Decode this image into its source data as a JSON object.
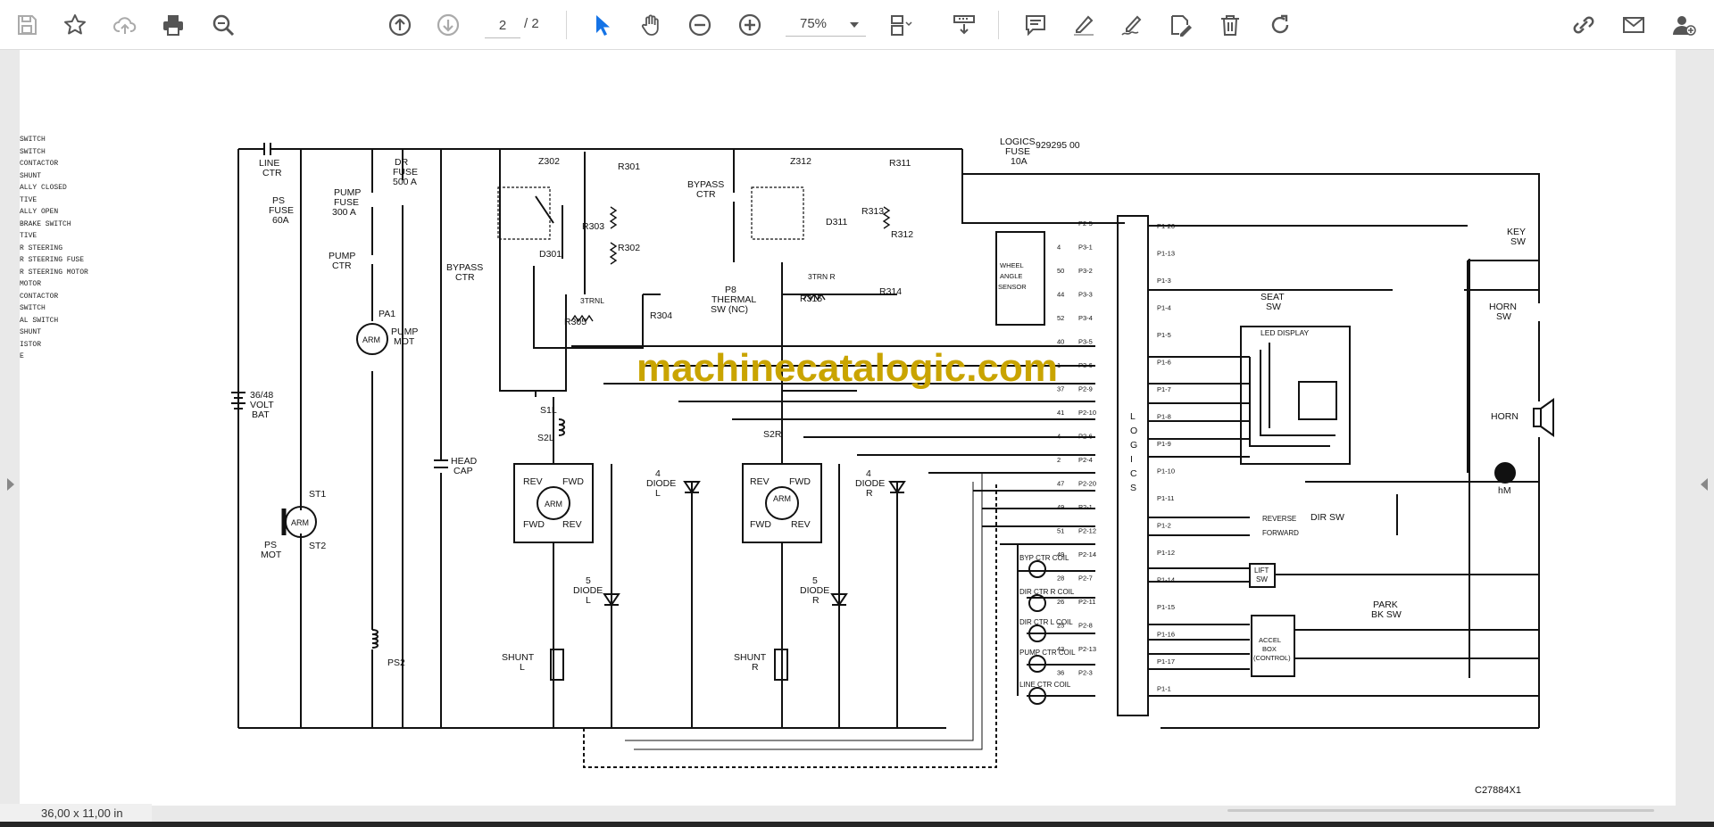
{
  "toolbar": {
    "page_current": "2",
    "page_total": "/ 2",
    "zoom": "75%",
    "icons": [
      "save-icon",
      "bookmark-star-icon",
      "cloud-upload-icon",
      "print-icon",
      "zoom-search-icon",
      "page-up-icon",
      "page-down-icon",
      "select-cursor-icon",
      "hand-pan-icon",
      "zoom-out-icon",
      "zoom-in-icon",
      "page-fit-icon",
      "scroll-mode-icon",
      "comment-icon",
      "highlight-pen-icon",
      "draw-sign-icon",
      "edit-text-icon",
      "delete-icon",
      "rotate-icon",
      "share-link-icon",
      "email-icon",
      "add-user-icon"
    ],
    "accent": "#1473e6"
  },
  "status": {
    "page_size": "36,00 x 11,00 in"
  },
  "document": {
    "watermark": "machinecatalogic.com",
    "doc_code": "929295 00",
    "drawing_no": "C27884X1",
    "legend_fragments": [
      "SWITCH",
      "SWITCH",
      "CONTACTOR",
      "SHUNT",
      "ALLY CLOSED",
      "TIVE",
      "ALLY OPEN",
      "BRAKE SWITCH",
      "TIVE",
      "R STEERING",
      "R STEERING FUSE",
      "R STEERING MOTOR",
      "MOTOR",
      "CONTACTOR",
      "SWITCH",
      "AL SWITCH",
      "SHUNT",
      "ISTOR",
      "E"
    ],
    "labels": {
      "line_ctr": "LINE\nCTR",
      "ps_fuse": "PS\nFUSE\n60A",
      "pump_fuse": "PUMP\nFUSE\n300 A",
      "dr_fuse": "DR\nFUSE\n500 A",
      "pump_ctr": "PUMP\nCTR",
      "pa1": "PA1",
      "pump_mot": "PUMP\nMOT",
      "arm": "ARM",
      "bat": "36/48\nVOLT\nBAT",
      "st1": "ST1",
      "st2": "ST2",
      "ps_mot": "PS\nMOT",
      "ps2": "PS2",
      "head_cap": "HEAD\nCAP",
      "bypass_ctr_l": "BYPASS\nCTR",
      "bypass_ctr_r": "BYPASS\nCTR",
      "z302": "Z302",
      "z312": "Z312",
      "r301": "R301",
      "r302": "R302",
      "r303": "R303",
      "r304": "R304",
      "r305": "R305",
      "r311": "R311",
      "r312": "R312",
      "r313": "R313",
      "r314": "R314",
      "r315": "R315",
      "d301": "D301",
      "d311": "D311",
      "ptrn_l": "3TRN L",
      "ptrn_r": "3TRN R",
      "thermal_sw": "P8\nTHERMAL\nSW (NC)",
      "s1l": "S1L",
      "s2l": "S2L",
      "s2r": "S2R",
      "rev": "REV",
      "fwd": "FWD",
      "diode_l": "4\nDIODE\nL",
      "diode_r": "4\nDIODE\nR",
      "diode5_l": "5\nDIODE\nL",
      "diode5_r": "5\nDIODE\nR",
      "shunt_l": "SHUNT\nL",
      "shunt_r": "SHUNT\nR",
      "logics_fuse": "LOGICS\nFUSE\n10A",
      "wheel_angle": "WHEEL\nANGLE\nSENSOR",
      "logics": "LOGICS",
      "led_display": "LED DISPLAY",
      "seat_sw": "SEAT\nSW",
      "key_sw": "KEY\nSW",
      "horn_sw": "HORN\nSW",
      "horn": "HORN",
      "hm": "hM",
      "dir_sw": "DIR SW",
      "reverse": "REVERSE",
      "forward": "FORWARD",
      "lift_sw": "LIFT\nSW",
      "park_bk_sw": "PARK\nBK SW",
      "accel_box": "ACCEL\nBOX\n(CONTROL)",
      "byp_coil": "BYP CTR COIL",
      "dir_r_coil": "DIR CTR R COIL",
      "dir_l_coil": "DIR CTR L COIL",
      "pump_coil": "PUMP CTR COIL",
      "line_coil": "LINE CTR COIL"
    },
    "p2_pins": [
      "P2-5",
      "P3-1",
      "P3-2",
      "P3-3",
      "P3-4",
      "P3-5",
      "P3-6",
      "P2-9",
      "P2-10",
      "P2-6",
      "P2-4",
      "P2-20",
      "P2-1",
      "P2-12",
      "P2-14",
      "P2-7",
      "P2-11",
      "P2-8",
      "P2-13",
      "P2-3"
    ],
    "p2_wires": [
      "",
      "4",
      "50",
      "44",
      "52",
      "40",
      "1",
      "37",
      "41",
      "4",
      "2",
      "47",
      "49",
      "51",
      "49",
      "28",
      "26",
      "25",
      "43",
      "36"
    ],
    "p1_pins": [
      "P1-20",
      "P1-13",
      "P1-3",
      "P1-4",
      "P1-5",
      "P1-6",
      "P1-7",
      "P1-8",
      "P1-9",
      "P1-10",
      "P1-11",
      "P1-2",
      "P1-12",
      "P1-14",
      "P1-15",
      "P1-16",
      "P1-17",
      "P1-1"
    ]
  }
}
